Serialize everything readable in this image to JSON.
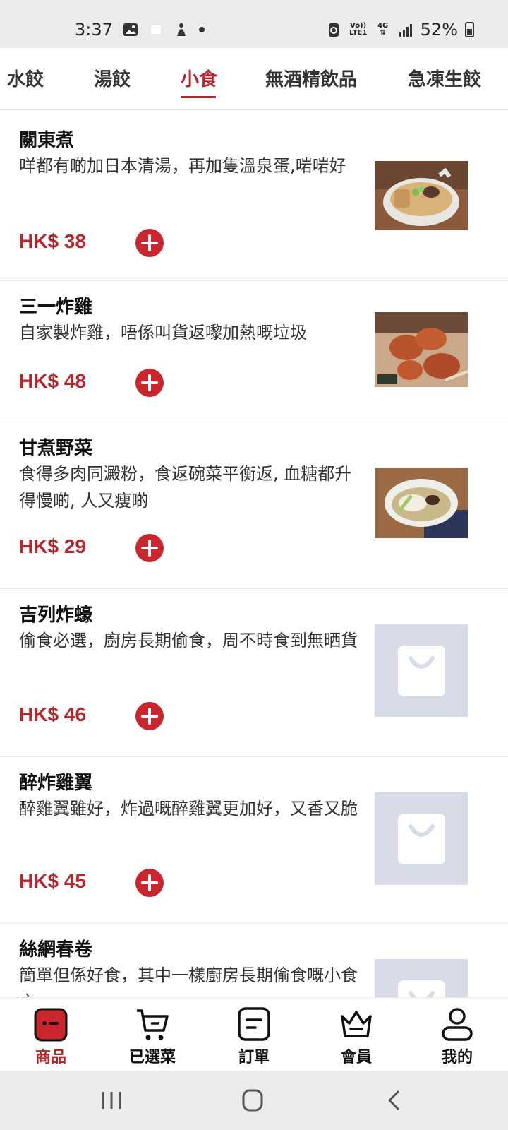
{
  "status_bar": {
    "time": "3:37",
    "network_top": "Vo))",
    "network_bottom": "LTE1",
    "signal_label": "4G",
    "battery": "52%"
  },
  "categories": {
    "items": [
      "水餃",
      "湯餃",
      "小食",
      "無酒精飲品",
      "急凍生餃"
    ],
    "active": "小食"
  },
  "products": [
    {
      "name": "關東煮",
      "desc": "咩都有啲加日本清湯，再加隻溫泉蛋,啱啱好",
      "price": "HK$ 38",
      "image": "oden-photo"
    },
    {
      "name": "三一炸雞",
      "desc": "自家製炸雞，唔係叫貨返嚟加熱嘅垃圾",
      "price": "HK$ 48",
      "image": "fried-chicken-photo"
    },
    {
      "name": "甘煮野菜",
      "desc": "食得多肉同澱粉，食返碗菜平衡返, 血糖都升得慢啲, 人又瘦啲",
      "price": "HK$ 29",
      "image": "braised-vegetables-photo"
    },
    {
      "name": "吉列炸蠔",
      "desc": "偷食必選，廚房長期偷食，周不時食到無晒貨",
      "price": "HK$ 46",
      "image": "placeholder-bag-icon"
    },
    {
      "name": "醉炸雞翼",
      "desc": "醉雞翼雖好，炸過嘅醉雞翼更加好，又香又脆",
      "price": "HK$ 45",
      "image": "placeholder-bag-icon"
    },
    {
      "name": "絲網春卷",
      "desc": "簡單但係好食，其中一樣廚房長期偷食嘅小食之一",
      "price": "",
      "image": "placeholder-bag-icon"
    }
  ],
  "bottom_nav": [
    {
      "label": "商品",
      "icon": "shop-icon",
      "active": true
    },
    {
      "label": "已選菜",
      "icon": "cart-icon",
      "active": false
    },
    {
      "label": "訂單",
      "icon": "order-icon",
      "active": false
    },
    {
      "label": "會員",
      "icon": "crown-icon",
      "active": false
    },
    {
      "label": "我的",
      "icon": "profile-icon",
      "active": false
    }
  ],
  "colors": {
    "accent": "#b5272d",
    "placeholder": "#d8dbe8"
  }
}
